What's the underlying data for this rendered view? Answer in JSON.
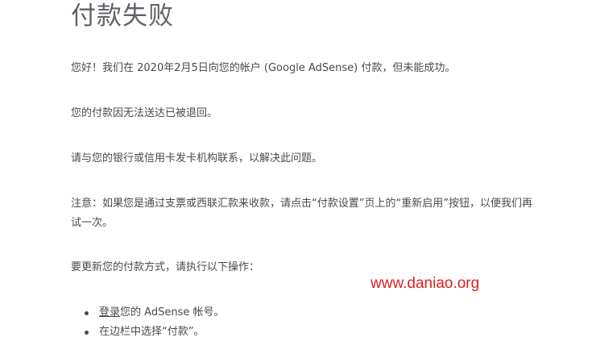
{
  "email": {
    "title": "付款失败",
    "paragraphs": {
      "p1": "您好！我们在 2020年2月5日向您的帐户 (Google AdSense) 付款，但未能成功。",
      "p2": "您的付款因无法送达已被退回。",
      "p3": "请与您的银行或信用卡发卡机构联系，以解决此问题。",
      "p4": "注意：如果您是通过支票或西联汇款来收款，请点击“付款设置”页上的“重新启用”按钮，以便我们再试一次。",
      "p5": "要更新您的付款方式，请执行以下操作："
    },
    "steps": {
      "step1_link": "登录",
      "step1_text": "您的 AdSense 帐号。",
      "step2_text": "在边栏中选择“付款”。"
    }
  },
  "watermark": {
    "text": "www.daniao.org",
    "color": "#e02020"
  }
}
